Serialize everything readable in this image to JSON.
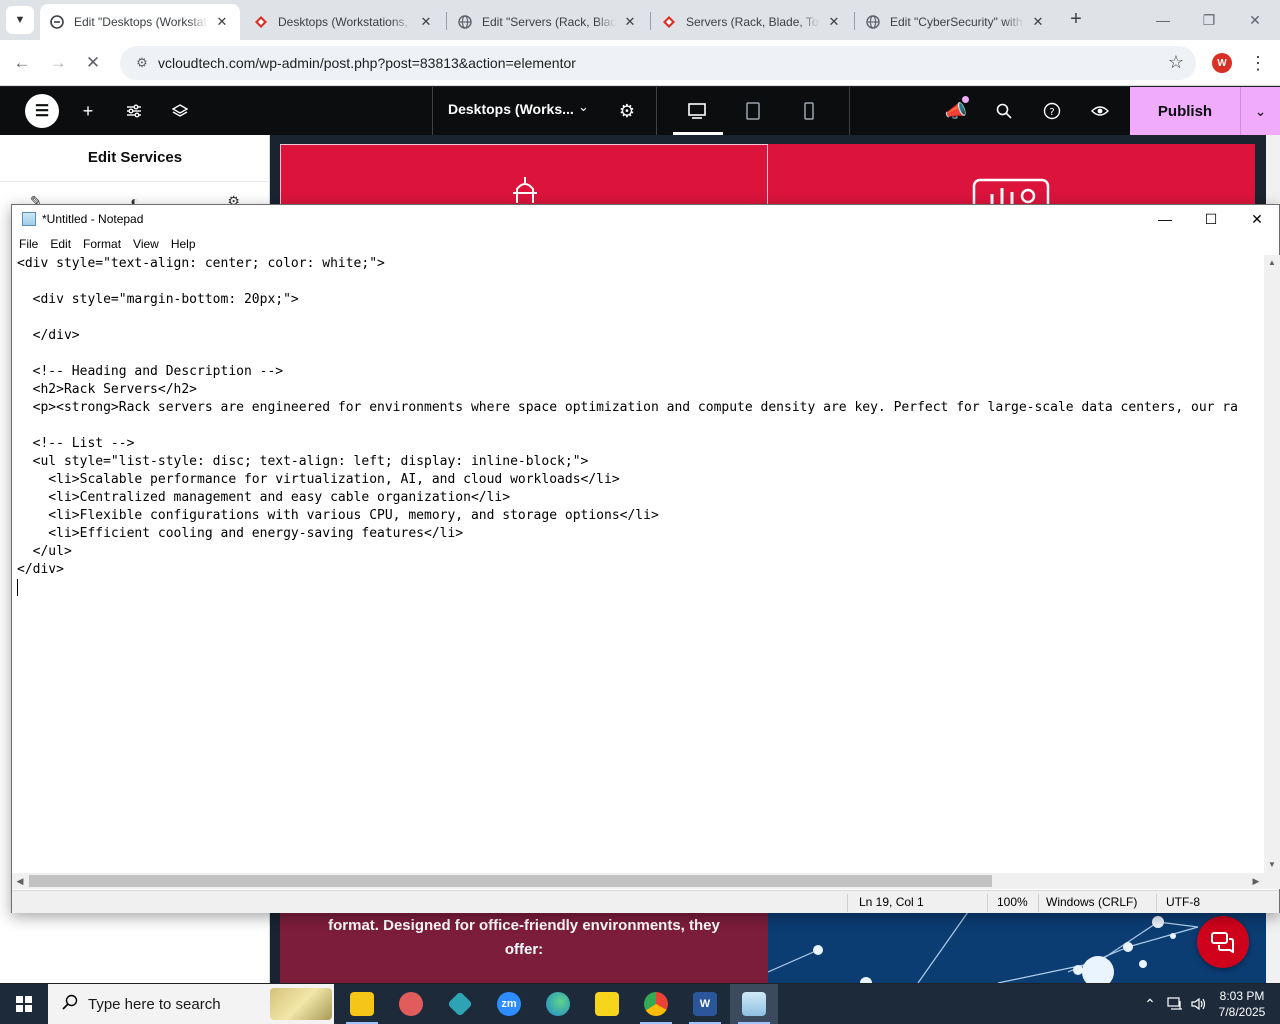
{
  "browser": {
    "tabs": [
      {
        "title": "Edit \"Desktops (Workstations)\"",
        "active": true,
        "favicon": "elementor-icon"
      },
      {
        "title": "Desktops (Workstations, All-in-One)",
        "active": false,
        "favicon": "site-icon"
      },
      {
        "title": "Edit \"Servers (Rack, Blade, Tower)\"",
        "active": false,
        "favicon": "globe-icon"
      },
      {
        "title": "Servers (Rack, Blade, Tower)",
        "active": false,
        "favicon": "site-icon"
      },
      {
        "title": "Edit \"CyberSecurity\" with Elementor",
        "active": false,
        "favicon": "globe-icon"
      }
    ],
    "url": "vcloudtech.com/wp-admin/post.php?post=83813&action=elementor",
    "profile_initial": "W"
  },
  "elementor": {
    "document_title": "Desktops (Works...",
    "publish_label": "Publish",
    "panel_title": "Edit Services",
    "canvas_text_line1": "format. Designed for office-friendly environments, they",
    "canvas_text_line2": "offer:"
  },
  "notepad": {
    "title": "*Untitled - Notepad",
    "menu": [
      "File",
      "Edit",
      "Format",
      "View",
      "Help"
    ],
    "lines": [
      "<div style=\"text-align: center; color: white;\">",
      "",
      "  <div style=\"margin-bottom: 20px;\">",
      "",
      "  </div>",
      "",
      "  <!-- Heading and Description -->",
      "  <h2>Rack Servers</h2>",
      "  <p><strong>Rack servers are engineered for environments where space optimization and compute density are key. Perfect for large-scale data centers, our ra",
      "",
      "  <!-- List -->",
      "  <ul style=\"list-style: disc; text-align: left; display: inline-block;\">",
      "    <li>Scalable performance for virtualization, AI, and cloud workloads</li>",
      "    <li>Centralized management and easy cable organization</li>",
      "    <li>Flexible configurations with various CPU, memory, and storage options</li>",
      "    <li>Efficient cooling and energy-saving features</li>",
      "  </ul>",
      "</div>"
    ],
    "status": {
      "position": "Ln 19, Col 1",
      "zoom": "100%",
      "line_ending": "Windows (CRLF)",
      "encoding": "UTF-8"
    }
  },
  "taskbar": {
    "search_placeholder": "Type here to search",
    "time": "8:03 PM",
    "date": "7/8/2025",
    "apps": [
      {
        "name": "file-explorer-icon",
        "label": "",
        "color": "#f5c518"
      },
      {
        "name": "snipping-tool-icon",
        "label": "",
        "color": "#e25c5c"
      },
      {
        "name": "app-diamond-icon",
        "label": "",
        "color": "#2ea3b3"
      },
      {
        "name": "zoom-icon",
        "label": "zm",
        "color": "#2d8cff"
      },
      {
        "name": "edge-icon",
        "label": "",
        "color": "#1e88c8"
      },
      {
        "name": "sticky-notes-icon",
        "label": "",
        "color": "#f7d51d"
      },
      {
        "name": "chrome-icon",
        "label": "",
        "color": "#34a853"
      },
      {
        "name": "word-icon",
        "label": "W",
        "color": "#2b579a"
      },
      {
        "name": "notepad-icon",
        "label": "",
        "color": "#8fc1e3"
      }
    ]
  },
  "colors": {
    "publish": "#f0abfc",
    "elementor_bar": "#0c0d0e",
    "card_red": "#dc143c",
    "taskbar": "#1c2a3a"
  }
}
